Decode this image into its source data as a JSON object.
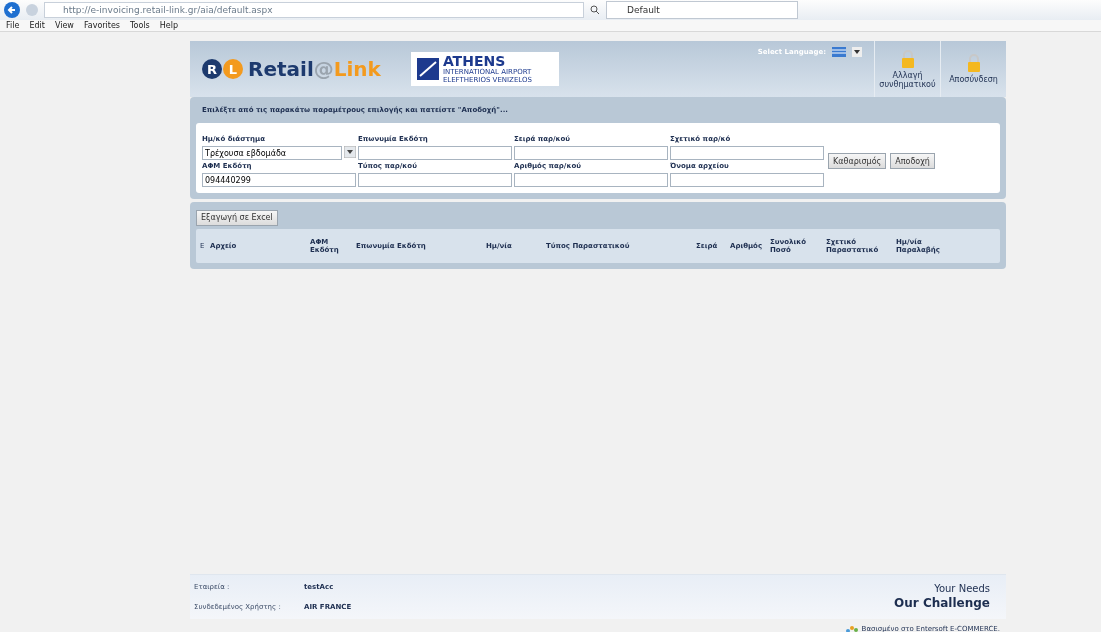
{
  "browser": {
    "address": "http://e-invoicing.retail-link.gr/aia/default.aspx",
    "tab": {
      "title": "Default",
      "selected": true
    },
    "menu": [
      "File",
      "Edit",
      "View",
      "Favorites",
      "Tools",
      "Help"
    ]
  },
  "header": {
    "logo": {
      "badge": [
        "R",
        "L"
      ],
      "name": "Retail",
      "at": "@",
      "suffix": "Link"
    },
    "partner": {
      "name": "ATHENS",
      "line1": "INTERNATIONAL AIRPORT",
      "line2": "ELEFTHERIOS VENIZELOS"
    },
    "language": {
      "label": "Select Language:"
    },
    "actions": [
      {
        "label": "Αλλαγή συνθηματικού"
      },
      {
        "label": "Αποσύνδεση"
      }
    ]
  },
  "filters": {
    "title": "Επιλέξτε από τις παρακάτω παραμέτρους επιλογής και πατείστε \"Αποδοχή\"...",
    "fields": [
      {
        "label": "Ημ/κό διάστημα",
        "kind": "select",
        "value": "Τρέχουσα εβδομάδα"
      },
      {
        "label": "Επωνυμία Εκδότη",
        "kind": "text"
      },
      {
        "label": "Σειρά παρ/κού",
        "kind": "text"
      },
      {
        "label": "Σχετικό παρ/κό",
        "kind": "text"
      },
      {
        "label": "ΑΦΜ Εκδότη",
        "kind": "text",
        "value": "094440299"
      },
      {
        "label": "Τύπος παρ/κού",
        "kind": "text"
      },
      {
        "label": "Αριθμός παρ/κού",
        "kind": "text"
      },
      {
        "label": "Όνομα αρχείου",
        "kind": "text"
      }
    ],
    "buttons": [
      "Καθαρισμός",
      "Αποδοχή"
    ]
  },
  "grid": {
    "export": "Εξαγωγή σε Excel",
    "expander": "Ε",
    "columns": [
      "Αρχείο",
      "ΑΦΜ Εκδότη",
      "Επωνυμία Εκδότη",
      "Ημ/νία",
      "Τύπος Παραστατικού",
      "Σειρά",
      "Αριθμός",
      "Συνολικό Ποσό",
      "Σχετικό Παραστατικό",
      "Ημ/νία Παραλαβής"
    ]
  },
  "footer": {
    "rows": [
      {
        "label": "Εταιρεία :",
        "value": "testAcc"
      },
      {
        "label": "Συνδεδεμένος Χρήστης :",
        "value": "AIR FRANCE"
      }
    ],
    "slogan": [
      "Your Needs",
      "Our Challenge"
    ],
    "credit": "Βασισμένο στο Entersoft E-COMMERCE."
  }
}
